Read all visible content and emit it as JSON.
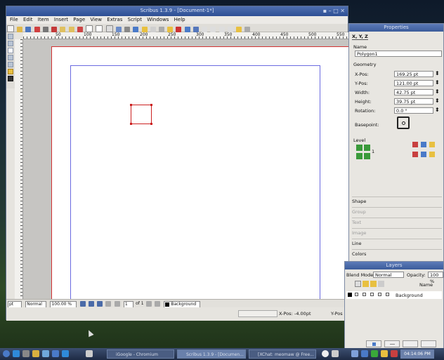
{
  "window": {
    "title": "Scribus 1.3.9 - [Document-1*]",
    "controls": "▪ – □ ✕"
  },
  "menu": [
    "File",
    "Edit",
    "Item",
    "Insert",
    "Page",
    "View",
    "Extras",
    "Script",
    "Windows",
    "Help"
  ],
  "ruler_marks": [
    "50",
    "100",
    "150",
    "200",
    "250",
    "300",
    "350",
    "400",
    "450",
    "500",
    "550"
  ],
  "status": {
    "unit": "pt",
    "mode": "Normal",
    "zoom": "100.00 %",
    "page_num": "1",
    "page_of": "of 1",
    "layer": "Background",
    "xpos_label": "X-Pos:",
    "xpos_value": "-4.00pt",
    "ypos_label": "Y-Pos"
  },
  "properties": {
    "title": "Properties",
    "tab_xyz": "X, Y, Z",
    "name_label": "Name",
    "name_value": "Polygon1",
    "geometry_label": "Geometry",
    "xpos_label": "X-Pos:",
    "xpos_value": "169.25 pt",
    "ypos_label": "Y-Pos:",
    "ypos_value": "121.00 pt",
    "width_label": "Width:",
    "width_value": "42.75 pt",
    "height_label": "Height:",
    "height_value": "39.75 pt",
    "rotation_label": "Rotation:",
    "rotation_value": "0.0 °",
    "basepoint_label": "Basepoint:",
    "level_label": "Level",
    "level_value": "1",
    "sections": [
      "Shape",
      "Group",
      "Text",
      "Image",
      "Line",
      "Colors"
    ]
  },
  "layers": {
    "title": "Layers",
    "blend_label": "Blend Mode:",
    "blend_value": "Normal",
    "opacity_label": "Opacity:",
    "opacity_value": "100 %",
    "name_header": "Name",
    "row_name": "Background"
  },
  "taskbar": {
    "tasks": [
      {
        "label": "iGoogle - Chromium"
      },
      {
        "label": "Scribus 1.3.9 - [Documen..."
      },
      {
        "label": "[XChat: meomaw @ Free..."
      }
    ],
    "clock": "04:14:06 PM"
  },
  "colors": {
    "title_bar": "#3b5c9b",
    "page_border": "#d23232",
    "margin_guide": "#6a6ae0"
  }
}
